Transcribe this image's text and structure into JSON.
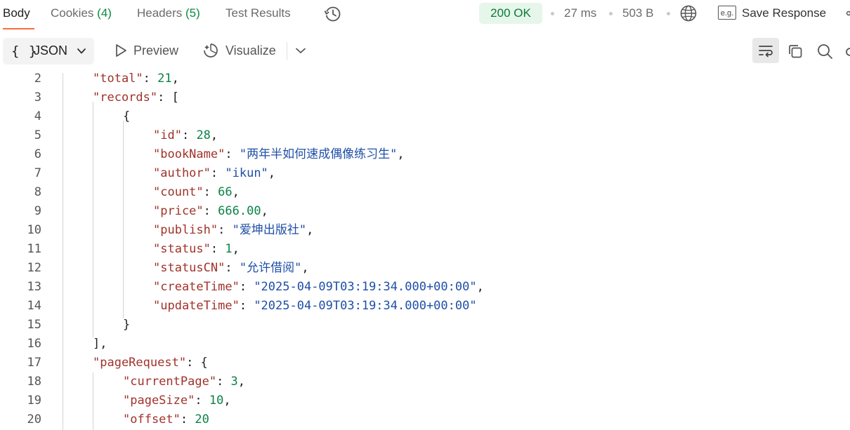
{
  "tabs": {
    "body": "Body",
    "cookies_label": "Cookies",
    "cookies_count": "(4)",
    "headers_label": "Headers",
    "headers_count": "(5)",
    "test_results": "Test Results"
  },
  "status": {
    "code": "200 OK",
    "time": "27 ms",
    "size": "503 B",
    "save_response": "Save Response"
  },
  "icons": {
    "history": "history-icon",
    "globe": "globe-icon",
    "save": "example-icon",
    "wrap": "wrap-lines-icon",
    "copy": "copy-icon",
    "search": "search-icon"
  },
  "toolbar": {
    "format": "JSON",
    "format_braces": "{ }",
    "preview": "Preview",
    "visualize": "Visualize"
  },
  "colors": {
    "accent": "#ff6c37",
    "status_ok": "#0b7a35",
    "key": "#a0332b",
    "string": "#1f4fa6",
    "number": "#0c8247"
  },
  "editor": {
    "lines": [
      {
        "n": "2",
        "indent": 1,
        "tokens": [
          [
            "key",
            "\"total\""
          ],
          [
            "punct",
            ": "
          ],
          [
            "num",
            "21"
          ],
          [
            "punct",
            ","
          ]
        ]
      },
      {
        "n": "3",
        "indent": 1,
        "tokens": [
          [
            "key",
            "\"records\""
          ],
          [
            "punct",
            ": ["
          ]
        ]
      },
      {
        "n": "4",
        "indent": 2,
        "tokens": [
          [
            "punct",
            "{"
          ]
        ]
      },
      {
        "n": "5",
        "indent": 3,
        "tokens": [
          [
            "key",
            "\"id\""
          ],
          [
            "punct",
            ": "
          ],
          [
            "num",
            "28"
          ],
          [
            "punct",
            ","
          ]
        ]
      },
      {
        "n": "6",
        "indent": 3,
        "tokens": [
          [
            "key",
            "\"bookName\""
          ],
          [
            "punct",
            ": "
          ],
          [
            "str",
            "\"两年半如何速成偶像练习生\""
          ],
          [
            "punct",
            ","
          ]
        ]
      },
      {
        "n": "7",
        "indent": 3,
        "tokens": [
          [
            "key",
            "\"author\""
          ],
          [
            "punct",
            ": "
          ],
          [
            "str",
            "\"ikun\""
          ],
          [
            "punct",
            ","
          ]
        ]
      },
      {
        "n": "8",
        "indent": 3,
        "tokens": [
          [
            "key",
            "\"count\""
          ],
          [
            "punct",
            ": "
          ],
          [
            "num",
            "66"
          ],
          [
            "punct",
            ","
          ]
        ]
      },
      {
        "n": "9",
        "indent": 3,
        "tokens": [
          [
            "key",
            "\"price\""
          ],
          [
            "punct",
            ": "
          ],
          [
            "num",
            "666.00"
          ],
          [
            "punct",
            ","
          ]
        ]
      },
      {
        "n": "10",
        "indent": 3,
        "tokens": [
          [
            "key",
            "\"publish\""
          ],
          [
            "punct",
            ": "
          ],
          [
            "str",
            "\"爱坤出版社\""
          ],
          [
            "punct",
            ","
          ]
        ]
      },
      {
        "n": "11",
        "indent": 3,
        "tokens": [
          [
            "key",
            "\"status\""
          ],
          [
            "punct",
            ": "
          ],
          [
            "num",
            "1"
          ],
          [
            "punct",
            ","
          ]
        ]
      },
      {
        "n": "12",
        "indent": 3,
        "tokens": [
          [
            "key",
            "\"statusCN\""
          ],
          [
            "punct",
            ": "
          ],
          [
            "str",
            "\"允许借阅\""
          ],
          [
            "punct",
            ","
          ]
        ]
      },
      {
        "n": "13",
        "indent": 3,
        "tokens": [
          [
            "key",
            "\"createTime\""
          ],
          [
            "punct",
            ": "
          ],
          [
            "str",
            "\"2025-04-09T03:19:34.000+00:00\""
          ],
          [
            "punct",
            ","
          ]
        ]
      },
      {
        "n": "14",
        "indent": 3,
        "tokens": [
          [
            "key",
            "\"updateTime\""
          ],
          [
            "punct",
            ": "
          ],
          [
            "str",
            "\"2025-04-09T03:19:34.000+00:00\""
          ]
        ]
      },
      {
        "n": "15",
        "indent": 2,
        "tokens": [
          [
            "punct",
            "}"
          ]
        ]
      },
      {
        "n": "16",
        "indent": 1,
        "tokens": [
          [
            "punct",
            "],"
          ]
        ]
      },
      {
        "n": "17",
        "indent": 1,
        "tokens": [
          [
            "key",
            "\"pageRequest\""
          ],
          [
            "punct",
            ": {"
          ]
        ]
      },
      {
        "n": "18",
        "indent": 2,
        "tokens": [
          [
            "key",
            "\"currentPage\""
          ],
          [
            "punct",
            ": "
          ],
          [
            "num",
            "3"
          ],
          [
            "punct",
            ","
          ]
        ]
      },
      {
        "n": "19",
        "indent": 2,
        "tokens": [
          [
            "key",
            "\"pageSize\""
          ],
          [
            "punct",
            ": "
          ],
          [
            "num",
            "10"
          ],
          [
            "punct",
            ","
          ]
        ]
      },
      {
        "n": "20",
        "indent": 2,
        "tokens": [
          [
            "key",
            "\"offset\""
          ],
          [
            "punct",
            ": "
          ],
          [
            "num",
            "20"
          ]
        ]
      }
    ]
  }
}
